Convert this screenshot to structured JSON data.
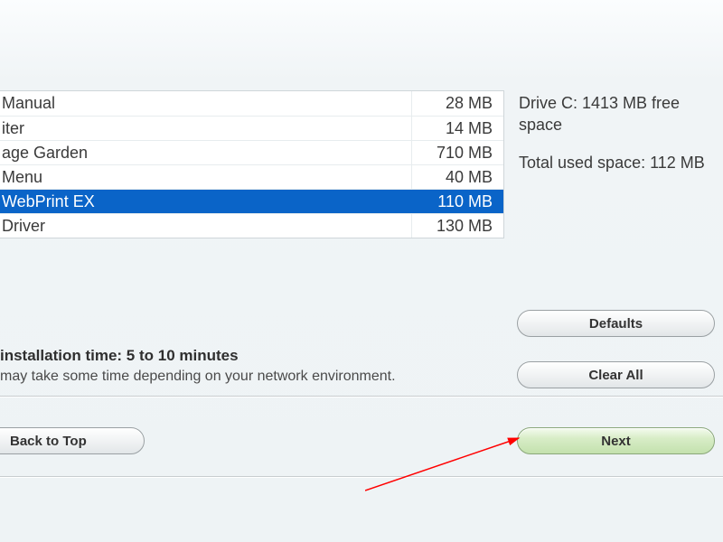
{
  "software_list": [
    {
      "name": " Manual",
      "size": "28 MB",
      "selected": false
    },
    {
      "name": "iter",
      "size": "14 MB",
      "selected": false
    },
    {
      "name": "age Garden",
      "size": "710 MB",
      "selected": false
    },
    {
      "name": "Menu",
      "size": "40 MB",
      "selected": false
    },
    {
      "name": "WebPrint EX",
      "size": "110 MB",
      "selected": true
    },
    {
      "name": "Driver",
      "size": "130 MB",
      "selected": false
    }
  ],
  "info": {
    "drive_free": "Drive C: 1413 MB free space",
    "total_used": "Total used space: 112 MB"
  },
  "est": {
    "title": "installation time: 5 to 10 minutes",
    "note": "may take some time depending on your network environment."
  },
  "buttons": {
    "defaults": "Defaults",
    "clear_all": "Clear All",
    "back_top": "Back to Top",
    "next": "Next"
  }
}
